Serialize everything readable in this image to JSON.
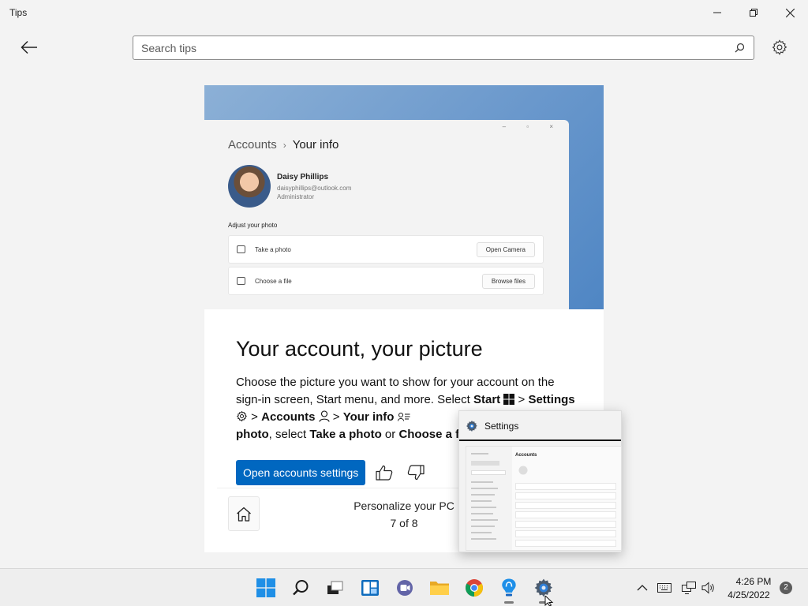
{
  "window": {
    "title": "Tips"
  },
  "search": {
    "placeholder": "Search tips",
    "value": ""
  },
  "tip": {
    "mock": {
      "breadcrumb_parent": "Accounts",
      "breadcrumb_current": "Your info",
      "user_name": "Daisy Phillips",
      "user_email": "daisyphillips@outlook.com",
      "user_role": "Administrator",
      "adjust_heading": "Adjust your photo",
      "row1_label": "Take a photo",
      "row1_button": "Open Camera",
      "row2_label": "Choose a file",
      "row2_button": "Browse files"
    },
    "title": "Your account, your picture",
    "body": {
      "p1": "Choose the picture you want to show for your account on the sign-in screen, Start menu, and more. Select ",
      "start": "Start",
      "gt1": " > ",
      "settings": "Settings",
      "gt2": " > ",
      "accounts": "Accounts",
      "gt3": " > ",
      "your_info": "Your info",
      "truncated_1": "",
      "photo": "photo",
      "p2": ", select ",
      "take_a_photo": "Take a photo",
      "or": " or ",
      "choose_a_file": "Choose a fi"
    },
    "primary_button": "Open accounts settings"
  },
  "nav": {
    "title": "Personalize your PC",
    "position": "7 of 8"
  },
  "thumbnail": {
    "title": "Settings",
    "section_title": "Accounts"
  },
  "taskbar": {
    "time": "4:26 PM",
    "date": "4/25/2022",
    "notifications": "2",
    "icons": [
      "start-icon",
      "search-icon",
      "task-view-icon",
      "widgets-icon",
      "chat-icon",
      "file-explorer-icon",
      "chrome-icon",
      "tips-icon",
      "settings-icon"
    ]
  },
  "colors": {
    "accent": "#0067c0",
    "background": "#f3f3f3"
  }
}
